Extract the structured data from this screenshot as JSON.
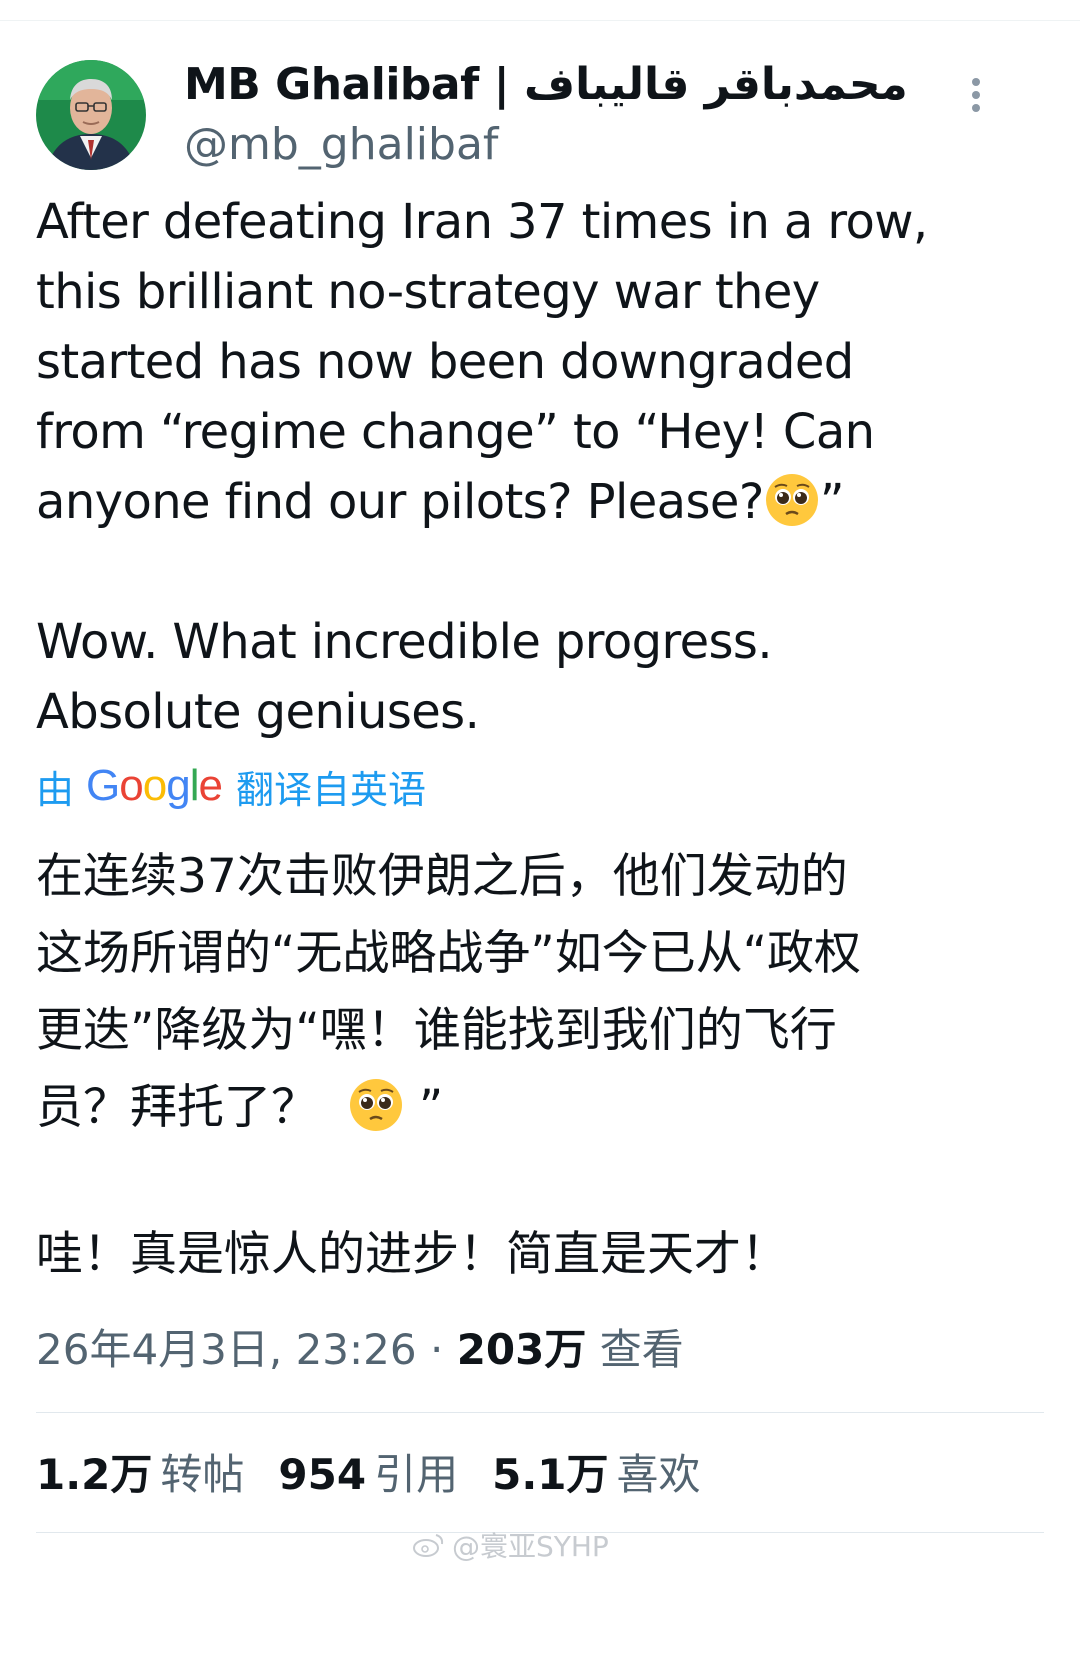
{
  "author": {
    "display_name": "MB Ghalibaf | محمدباقر قالیباف",
    "handle": "@mb_ghalibaf",
    "avatar_icon": "profile-photo-icon"
  },
  "tweet": {
    "lines": [
      "After defeating Iran 37 times in a row,",
      "this brilliant no-strategy war they",
      "started has now been downgraded",
      "from “regime change” to “Hey! Can",
      "anyone find our pilots? Please?"
    ],
    "line5_suffix": "”",
    "lines2": [
      "Wow. What incredible progress.",
      "Absolute geniuses."
    ],
    "emoji_icon": "pleading-face-emoji-icon"
  },
  "translation": {
    "prefix": "由",
    "google": [
      "G",
      "o",
      "o",
      "g",
      "l",
      "e"
    ],
    "suffix": "翻译自英语",
    "lines": [
      "在连续37次击败伊朗之后，他们发动的",
      "这场所谓的“无战略战争”如今已从“政权",
      "更迭”降级为“嘿！谁能找到我们的飞行",
      "员？拜托了？"
    ],
    "line4_suffix": "”",
    "line5": "哇！真是惊人的进步！简直是天才！"
  },
  "meta": {
    "timestamp": "26年4月3日, 23:26",
    "separator": " · ",
    "views_count": "203万",
    "views_label": "查看"
  },
  "stats": {
    "retweets_count": "1.2万",
    "retweets_label": "转帖",
    "quotes_count": "954",
    "quotes_label": "引用",
    "likes_count": "5.1万",
    "likes_label": "喜欢"
  },
  "watermark": {
    "text": "@寰亚SYHP",
    "icon": "weibo-logo-icon"
  },
  "colors": {
    "link_blue": "#1d9bf0",
    "secondary_gray": "#536471",
    "text_dark": "#0f1419"
  }
}
